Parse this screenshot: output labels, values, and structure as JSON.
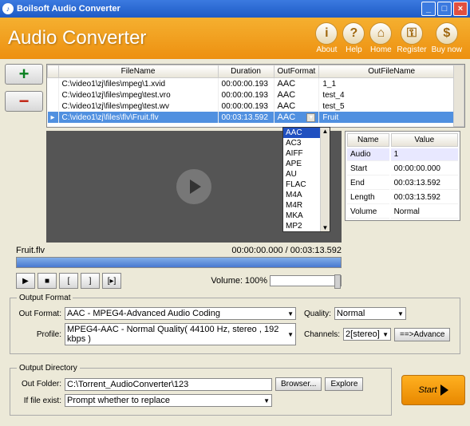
{
  "titlebar": {
    "text": "Boilsoft Audio Converter"
  },
  "app_title": "Audio Converter",
  "header_buttons": [
    {
      "icon": "i",
      "label": "About"
    },
    {
      "icon": "?",
      "label": "Help"
    },
    {
      "icon": "⌂",
      "label": "Home"
    },
    {
      "icon": "⚿",
      "label": "Register"
    },
    {
      "icon": "$",
      "label": "Buy now"
    }
  ],
  "table": {
    "cols": [
      "",
      "FileName",
      "Duration",
      "OutFormat",
      "OutFileName"
    ],
    "rows": [
      {
        "file": "C:\\video1\\zj\\files\\mpeg\\1.xvid",
        "dur": "00:00:00.193",
        "fmt": "AAC",
        "out": "1_1"
      },
      {
        "file": "C:\\video1\\zj\\files\\mpeg\\test.vro",
        "dur": "00:00:00.193",
        "fmt": "AAC",
        "out": "test_4"
      },
      {
        "file": "C:\\video1\\zj\\files\\mpeg\\test.wv",
        "dur": "00:00:00.193",
        "fmt": "AAC",
        "out": "test_5"
      },
      {
        "file": "C:\\video1\\zj\\files\\flv\\Fruit.flv",
        "dur": "00:03:13.592",
        "fmt": "AAC",
        "out": "Fruit",
        "sel": true
      }
    ]
  },
  "format_dropdown": [
    "AAC",
    "AC3",
    "AIFF",
    "APE",
    "AU",
    "FLAC",
    "M4A",
    "M4R",
    "MKA",
    "MP2"
  ],
  "props": {
    "cols": [
      "Name",
      "Value"
    ],
    "rows": [
      {
        "n": "Audio",
        "v": "1",
        "sel": true
      },
      {
        "n": "Start",
        "v": "00:00:00.000"
      },
      {
        "n": "End",
        "v": "00:03:13.592"
      },
      {
        "n": "Length",
        "v": "00:03:13.592"
      },
      {
        "n": "Volume",
        "v": "Normal"
      }
    ]
  },
  "timeline": {
    "file": "Fruit.flv",
    "time": "00:00:00.000 / 00:03:13.592"
  },
  "volume": {
    "label": "Volume:",
    "value": "100%"
  },
  "output_format": {
    "legend": "Output Format",
    "format_lbl": "Out Format:",
    "format_val": "AAC - MPEG4-Advanced Audio Coding",
    "profile_lbl": "Profile:",
    "profile_val": "MPEG4-AAC - Normal Quality( 44100 Hz, stereo , 192 kbps )",
    "quality_lbl": "Quality:",
    "quality_val": "Normal",
    "channels_lbl": "Channels:",
    "channels_val": "2[stereo]",
    "advance": "==>Advance"
  },
  "output_dir": {
    "legend": "Output Directory",
    "folder_lbl": "Out Folder:",
    "folder_val": "C:\\Torrent_AudioConverter\\123",
    "browse": "Browser...",
    "explore": "Explore",
    "exist_lbl": "If file exist:",
    "exist_val": "Prompt whether to replace"
  },
  "start": "Start"
}
